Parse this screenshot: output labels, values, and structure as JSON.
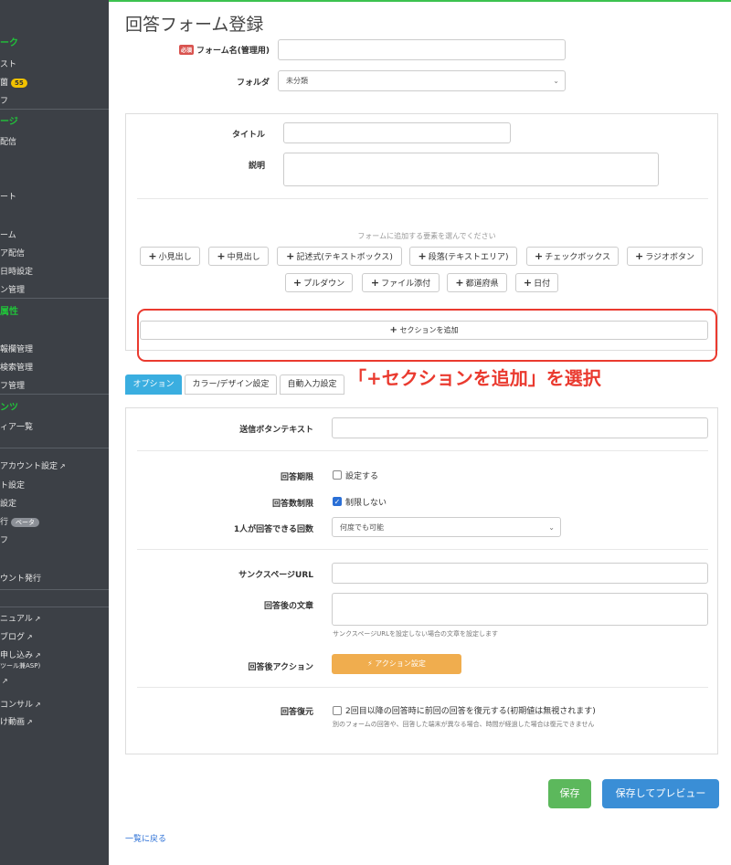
{
  "sidebar": {
    "items": [
      {
        "type": "head",
        "label": "ーク"
      },
      {
        "type": "item",
        "label": "スト"
      },
      {
        "type": "item",
        "label": "薗",
        "badge": "55"
      },
      {
        "type": "item",
        "label": "フ"
      },
      {
        "type": "head",
        "label": "ージ"
      },
      {
        "type": "item",
        "label": "配信"
      },
      {
        "type": "item",
        "label": "ート"
      },
      {
        "type": "item",
        "label": "ーム"
      },
      {
        "type": "item",
        "label": "ア配信"
      },
      {
        "type": "item",
        "label": "日時設定"
      },
      {
        "type": "item",
        "label": "ン管理"
      },
      {
        "type": "head",
        "label": "属性"
      },
      {
        "type": "item",
        "label": "報欄管理"
      },
      {
        "type": "item",
        "label": "検索管理"
      },
      {
        "type": "item",
        "label": "フ管理"
      },
      {
        "type": "head",
        "label": "ンツ"
      },
      {
        "type": "item",
        "label": "ィア一覧"
      },
      {
        "type": "item",
        "label": "アカウント設定"
      },
      {
        "type": "item",
        "label": "ト設定"
      },
      {
        "type": "item",
        "label": "設定"
      },
      {
        "type": "item",
        "label": "行",
        "badge": "ベータ"
      },
      {
        "type": "item",
        "label": "フ"
      },
      {
        "type": "item",
        "label": "ウント発行"
      },
      {
        "type": "item",
        "label": "ニュアル"
      },
      {
        "type": "item",
        "label": "ブログ"
      },
      {
        "type": "item",
        "label": "申し込み"
      },
      {
        "type": "item",
        "label": "ツール兼ASP)"
      },
      {
        "type": "item",
        "label": "コンサル"
      },
      {
        "type": "item",
        "label": "け動画"
      }
    ]
  },
  "page": {
    "title": "回答フォーム登録",
    "required_badge": "必須",
    "form_name_label": "フォーム名(管理用)",
    "folder_label": "フォルダ",
    "folder_value": "未分類",
    "title_label": "タイトル",
    "description_label": "説明"
  },
  "elements": {
    "hint": "フォームに追加する要素を選んでください",
    "buttons": [
      "小見出し",
      "中見出し",
      "記述式(テキストボックス)",
      "段落(テキストエリア)",
      "チェックボックス",
      "ラジオボタン",
      "プルダウン",
      "ファイル添付",
      "都道府県",
      "日付"
    ],
    "add_section": "セクションを追加"
  },
  "annotation": "「+セクションを追加」を選択",
  "tabs": [
    "オプション",
    "カラー/デザイン設定",
    "自動入力設定"
  ],
  "options": {
    "submit_text_label": "送信ボタンテキスト",
    "deadline_label": "回答期限",
    "deadline_check": "設定する",
    "limit_label": "回答数制限",
    "limit_check": "制限しない",
    "per_person_label": "1人が回答できる回数",
    "per_person_value": "何度でも可能",
    "thanks_url_label": "サンクスページURL",
    "after_text_label": "回答後の文章",
    "after_text_help": "サンクスページURLを設定しない場合の文章を設定します",
    "after_action_label": "回答後アクション",
    "after_action_button": "アクション設定",
    "restore_label": "回答復元",
    "restore_check": "2回目以降の回答時に前回の回答を復元する(初期値は無視されます)",
    "restore_help": "別のフォームの回答や、回答した端末が異なる場合、時間が経過した場合は復元できません"
  },
  "footer": {
    "save": "保存",
    "save_preview": "保存してプレビュー",
    "back": "一覧に戻る"
  },
  "colors": {
    "sidebar_bg": "#3c4046",
    "sidebar_head": "#21c23a",
    "tab_active": "#3aaee0",
    "save": "#5cb85c",
    "save_preview": "#3a8ed6",
    "action": "#f0ad4e",
    "annotation": "#ea3a2f"
  }
}
